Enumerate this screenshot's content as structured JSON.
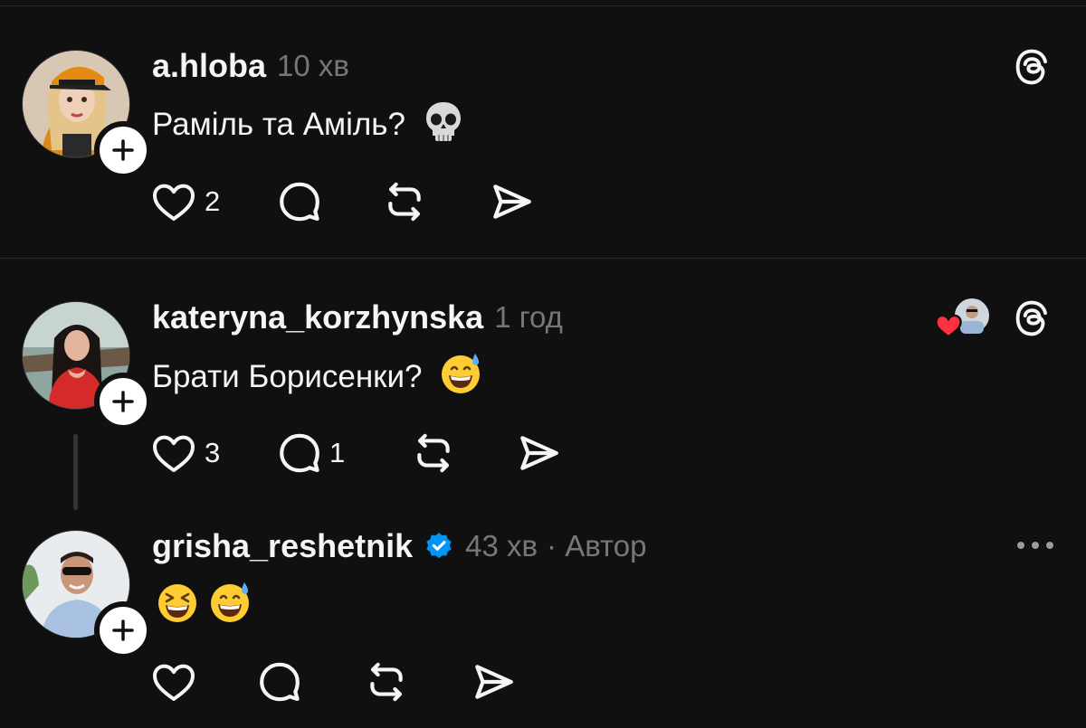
{
  "posts": [
    {
      "username": "a.hloba",
      "time": "10 хв",
      "text": "Раміль та Аміль?",
      "emoji": "skull-emoji",
      "likes": "2",
      "replies": "",
      "has_threads_logo": true
    },
    {
      "username": "kateryna_korzhynska",
      "time": "1 год",
      "text": "Брати Борисенки?",
      "emoji": "grinning-sweat-emoji",
      "likes": "3",
      "replies": "1",
      "has_threads_logo": true,
      "liked_by_author": true
    },
    {
      "username": "grisha_reshetnik",
      "verified": true,
      "time": "43 хв",
      "role": "· Автор",
      "emojis": [
        "laughing-squint-emoji",
        "grinning-sweat-emoji"
      ],
      "likes": "",
      "replies": ""
    }
  ],
  "icons": {
    "like": "heart-icon",
    "reply": "comment-icon",
    "repost": "repost-icon",
    "share": "send-icon",
    "app": "threads-logo-icon",
    "more": "more-dots-icon"
  },
  "colors": {
    "background": "#101010",
    "text": "#f3f5f7",
    "secondary": "#777777",
    "verified": "#0095f6",
    "heart": "#ff3040"
  }
}
